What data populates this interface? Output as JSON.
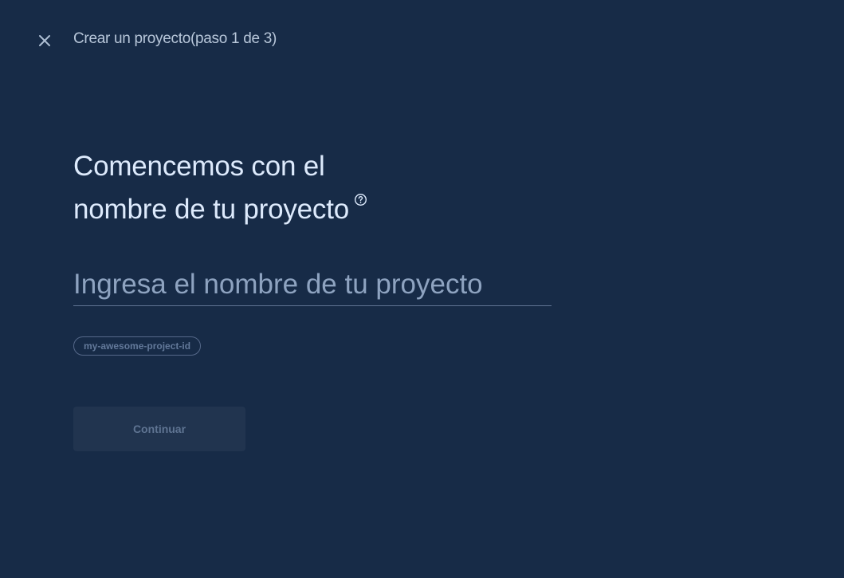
{
  "header": {
    "close_icon": "close-icon",
    "step_title": "Crear un proyecto(paso 1 de 3)"
  },
  "main": {
    "heading_line1": "Comencemos con el",
    "heading_line2": "nombre de tu proyecto",
    "help_icon": "help-circle-icon",
    "name_input": {
      "value": "",
      "placeholder": "Ingresa el nombre de tu proyecto"
    },
    "project_id": "my-awesome-project-id",
    "continue_label": "Continuar",
    "continue_enabled": false
  },
  "colors": {
    "background": "#172b47",
    "heading": "#ddeafc",
    "muted": "#b7c6d9",
    "placeholder": "#8ea3c0",
    "button_disabled_bg": "#21344f",
    "button_disabled_text": "#5f7492"
  }
}
